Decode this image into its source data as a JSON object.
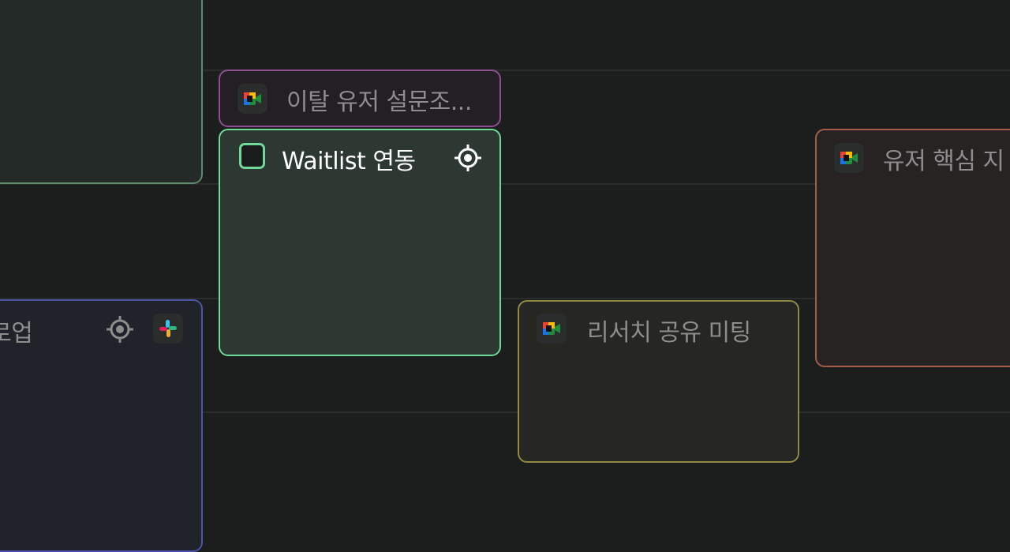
{
  "colors": {
    "background": "#1c1d1d",
    "grid_line": "#2b2c2c",
    "green_border": "#6fd99a",
    "purple_border": "#8b4f91",
    "olive_border": "#8f8a45",
    "red_border": "#a55b4a",
    "blue_border": "#4b54a8",
    "muted_text": "#8d8d8d"
  },
  "events": [
    {
      "id": "top-left",
      "title": "",
      "icon": "none"
    },
    {
      "id": "survey",
      "title": "이탈 유저 설문조...",
      "icon": "google-meet-icon"
    },
    {
      "id": "waitlist",
      "title": "Waitlist 연동",
      "icon": "checkbox",
      "trailing_icon": "target-icon",
      "selected": true
    },
    {
      "id": "followup",
      "title": "팔로업",
      "icon": "slack-icon",
      "leading_icon": "target-icon"
    },
    {
      "id": "research",
      "title": "리서치 공유 미팅",
      "icon": "google-meet-icon"
    },
    {
      "id": "core",
      "title": "유저 핵심 지",
      "icon": "google-meet-icon"
    }
  ]
}
